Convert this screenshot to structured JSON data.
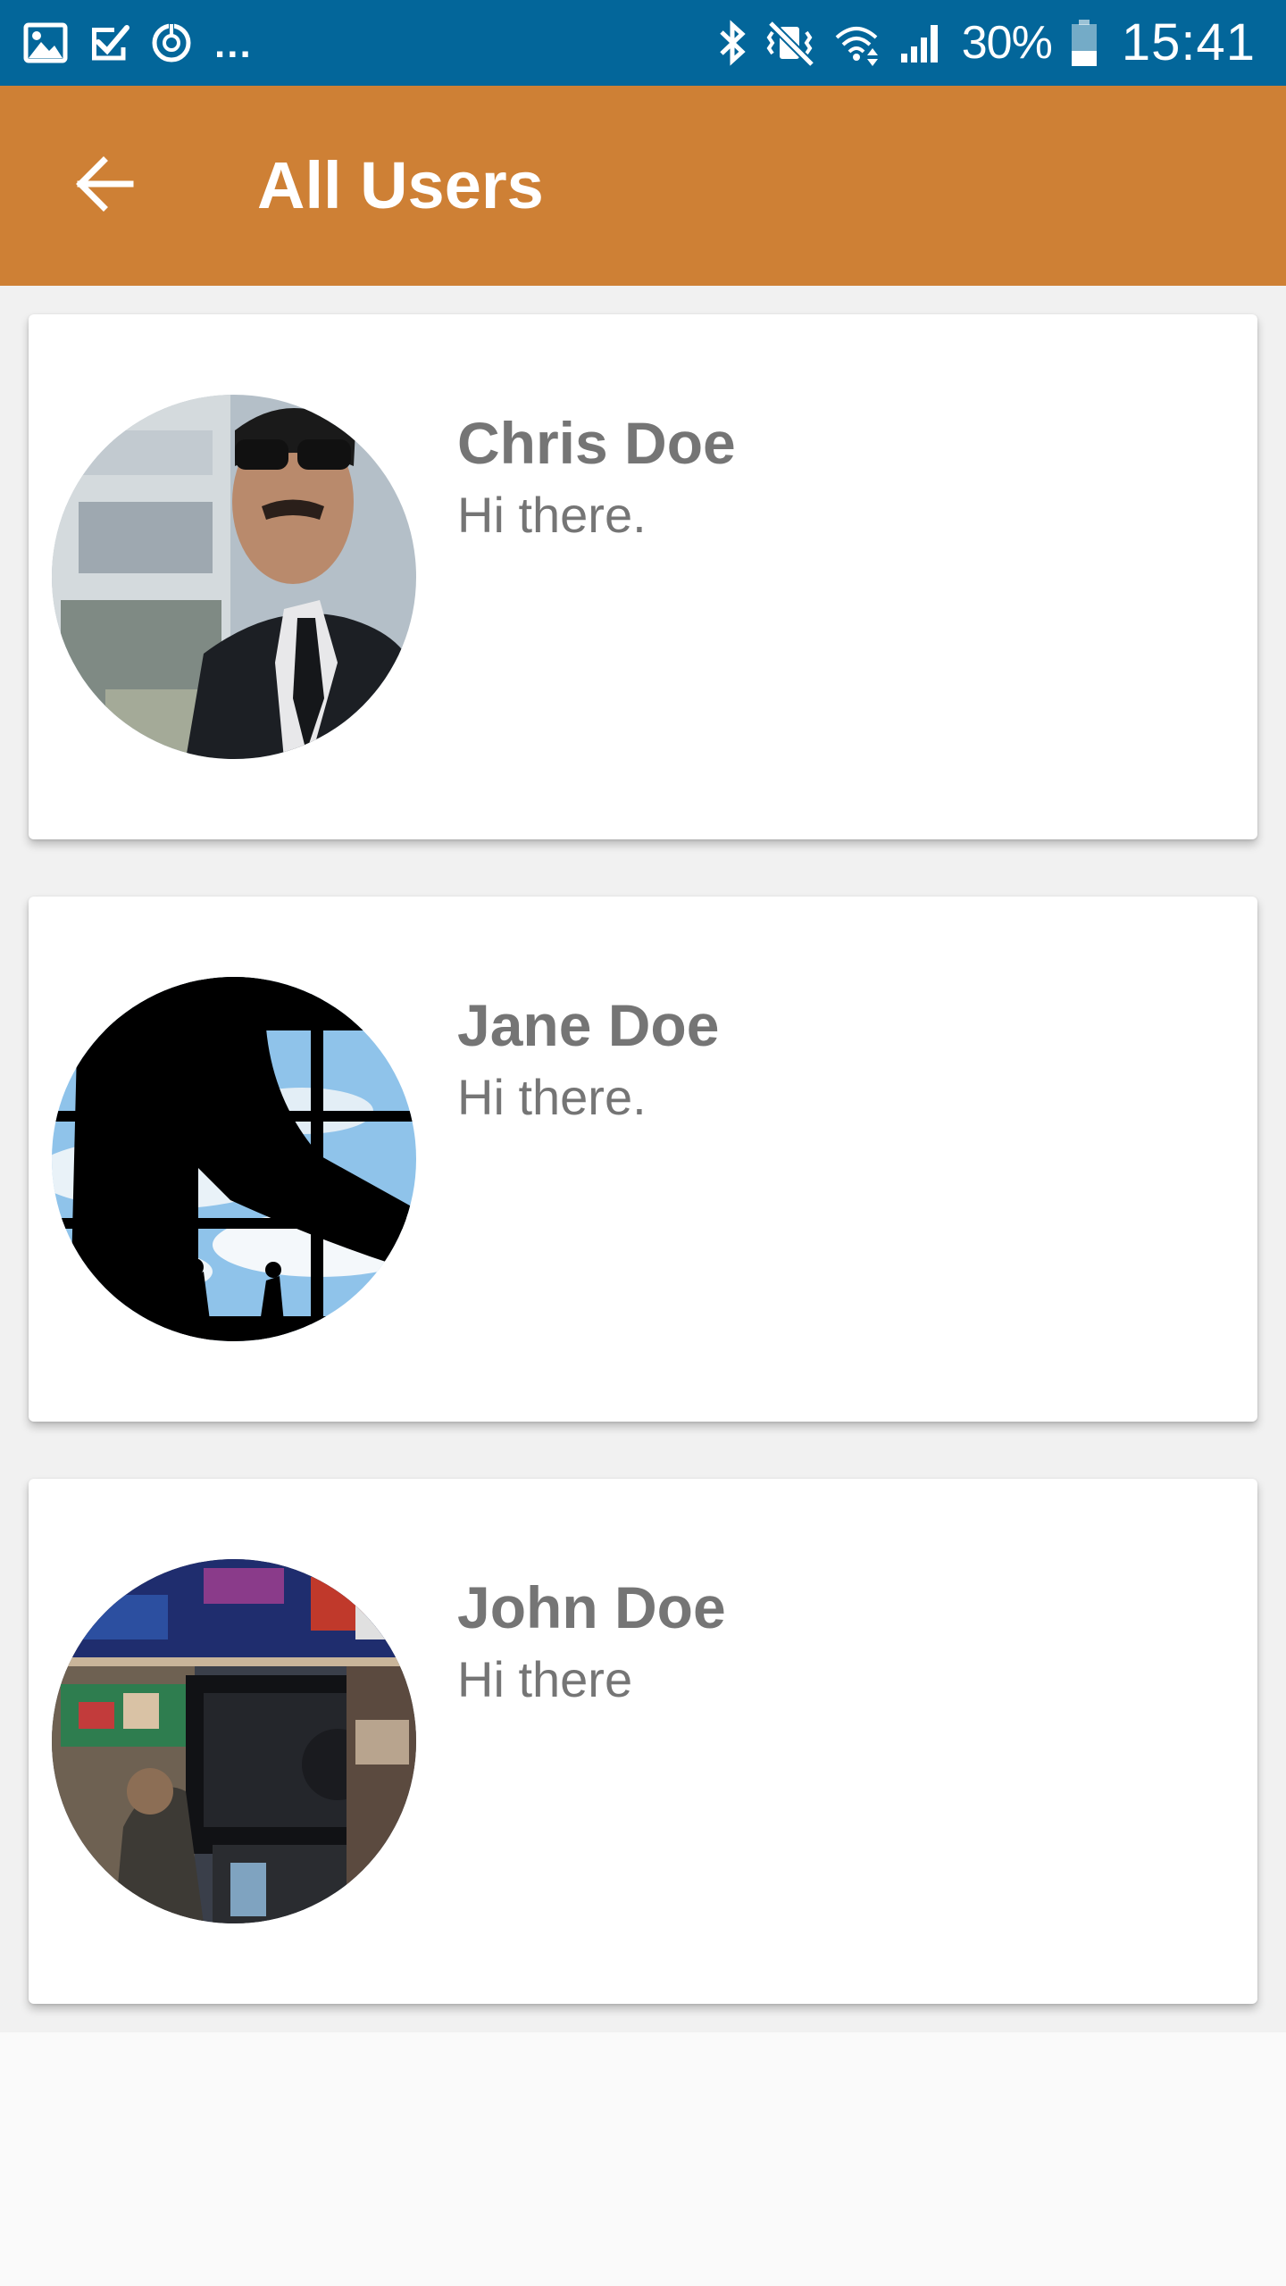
{
  "status_bar": {
    "battery_percent": "30%",
    "time": "15:41",
    "ellipsis": "...",
    "left_icons": [
      "gallery-icon",
      "task-done-icon",
      "sync-timer-icon"
    ],
    "right_icons": [
      "bluetooth-icon",
      "vibrate-mute-icon",
      "wifi-icon",
      "signal-icon",
      "battery-icon"
    ],
    "background_color": "#03669a"
  },
  "app_bar": {
    "title": "All Users",
    "back_icon": "arrow-back-icon",
    "background_color": "#ce8035"
  },
  "users": [
    {
      "name": "Chris Doe",
      "message": "Hi there."
    },
    {
      "name": "Jane Doe",
      "message": "Hi there."
    },
    {
      "name": "John Doe",
      "message": "Hi there"
    }
  ]
}
